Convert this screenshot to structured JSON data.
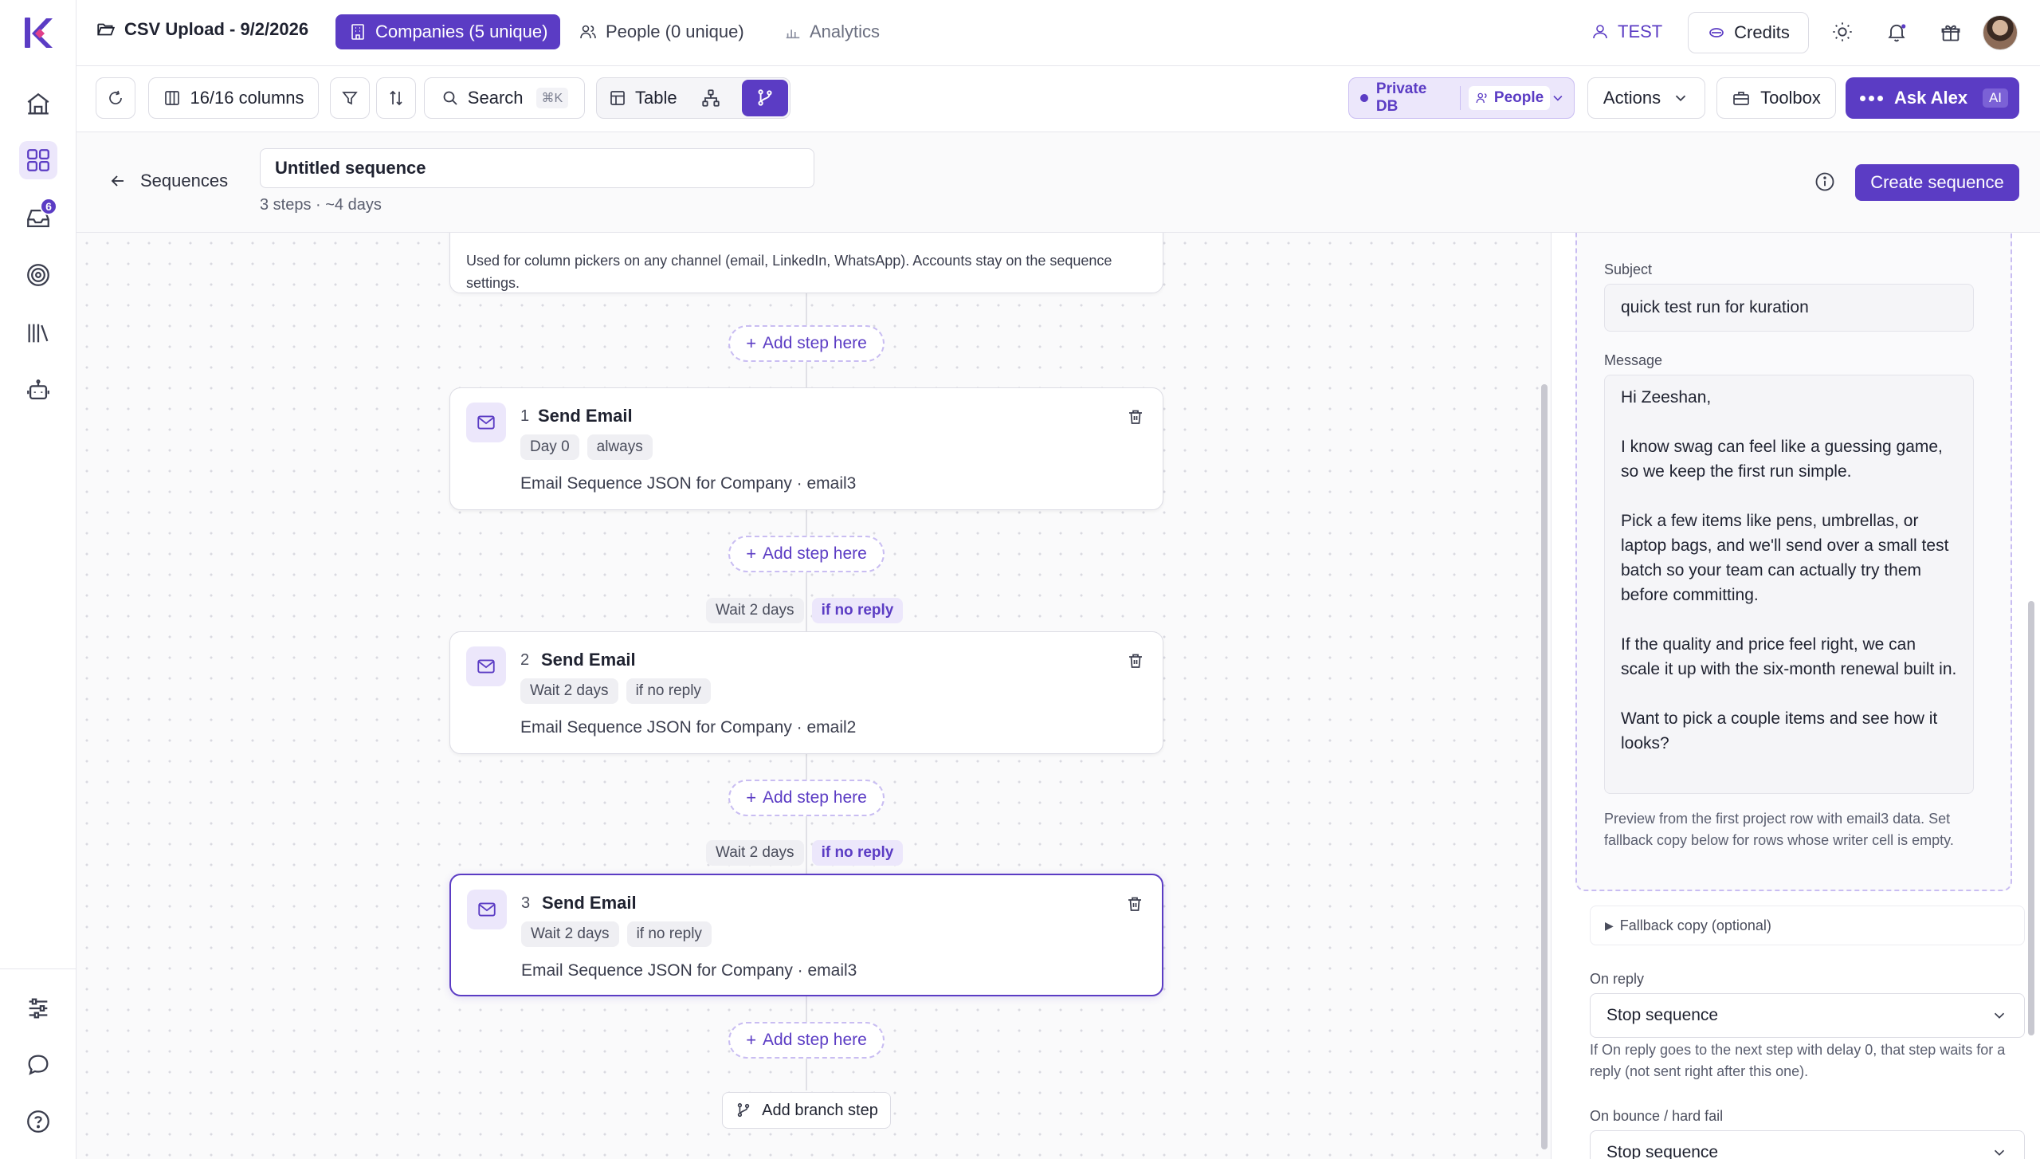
{
  "topbar": {
    "file_title": "CSV Upload - 9/2/2026",
    "tabs": {
      "companies": "Companies (5 unique)",
      "people": "People (0 unique)",
      "analytics": "Analytics"
    },
    "test_label": "TEST",
    "credits_label": "Credits"
  },
  "sidebar": {
    "inbox_badge": "6"
  },
  "toolbar": {
    "columns_label": "16/16 columns",
    "search_label": "Search",
    "search_shortcut": "⌘K",
    "table_label": "Table",
    "private_db_label": "Private DB",
    "people_label": "People",
    "actions_label": "Actions",
    "toolbox_label": "Toolbox",
    "ask_alex_label": "Ask Alex",
    "ai_badge": "AI"
  },
  "sequence_header": {
    "back_label": "Sequences",
    "name_value": "Untitled sequence",
    "meta": "3 steps · ~4 days",
    "create_label": "Create sequence"
  },
  "canvas": {
    "top_card_text": "Used for column pickers on any channel (email, LinkedIn, WhatsApp). Accounts stay on the sequence settings.",
    "add_step_label": "Add step here",
    "add_branch_label": "Add branch step",
    "steps": [
      {
        "number": "1",
        "title": "Send Email",
        "pills": [
          "Day 0",
          "always"
        ],
        "source": "Email Sequence JSON for Company · email3"
      },
      {
        "number": "2",
        "title": "Send Email",
        "pills": [
          "Wait 2 days",
          "if no reply"
        ],
        "source": "Email Sequence JSON for Company · email2",
        "wait_label": "Wait 2 days",
        "condition_label": "if no reply"
      },
      {
        "number": "3",
        "title": "Send Email",
        "pills": [
          "Wait 2 days",
          "if no reply"
        ],
        "source": "Email Sequence JSON for Company · email3",
        "wait_label": "Wait 2 days",
        "condition_label": "if no reply"
      }
    ]
  },
  "right_panel": {
    "subject_label": "Subject",
    "subject_value": "quick test run for kuration",
    "message_label": "Message",
    "message_value": "Hi Zeeshan,\n\nI know swag can feel like a guessing game, so we keep the first run simple.\n\nPick a few items like pens, umbrellas, or laptop bags, and we'll send over a small test batch so your team can actually try them before committing.\n\nIf the quality and price feel right, we can scale it up with the six-month renewal built in.\n\nWant to pick a couple items and see how it looks?",
    "preview_note": "Preview from the first project row with email3 data. Set fallback copy below for rows whose writer cell is empty.",
    "fallback_label": "Fallback copy (optional)",
    "on_reply_label": "On reply",
    "on_reply_value": "Stop sequence",
    "on_reply_note": "If On reply goes to the next step with delay 0, that step waits for a reply (not sent right after this one).",
    "on_bounce_label": "On bounce / hard fail",
    "on_bounce_value": "Stop sequence"
  },
  "colors": {
    "accent": "#5b3cc4",
    "accent_light": "#ece7fb",
    "border": "#dcdce4"
  }
}
